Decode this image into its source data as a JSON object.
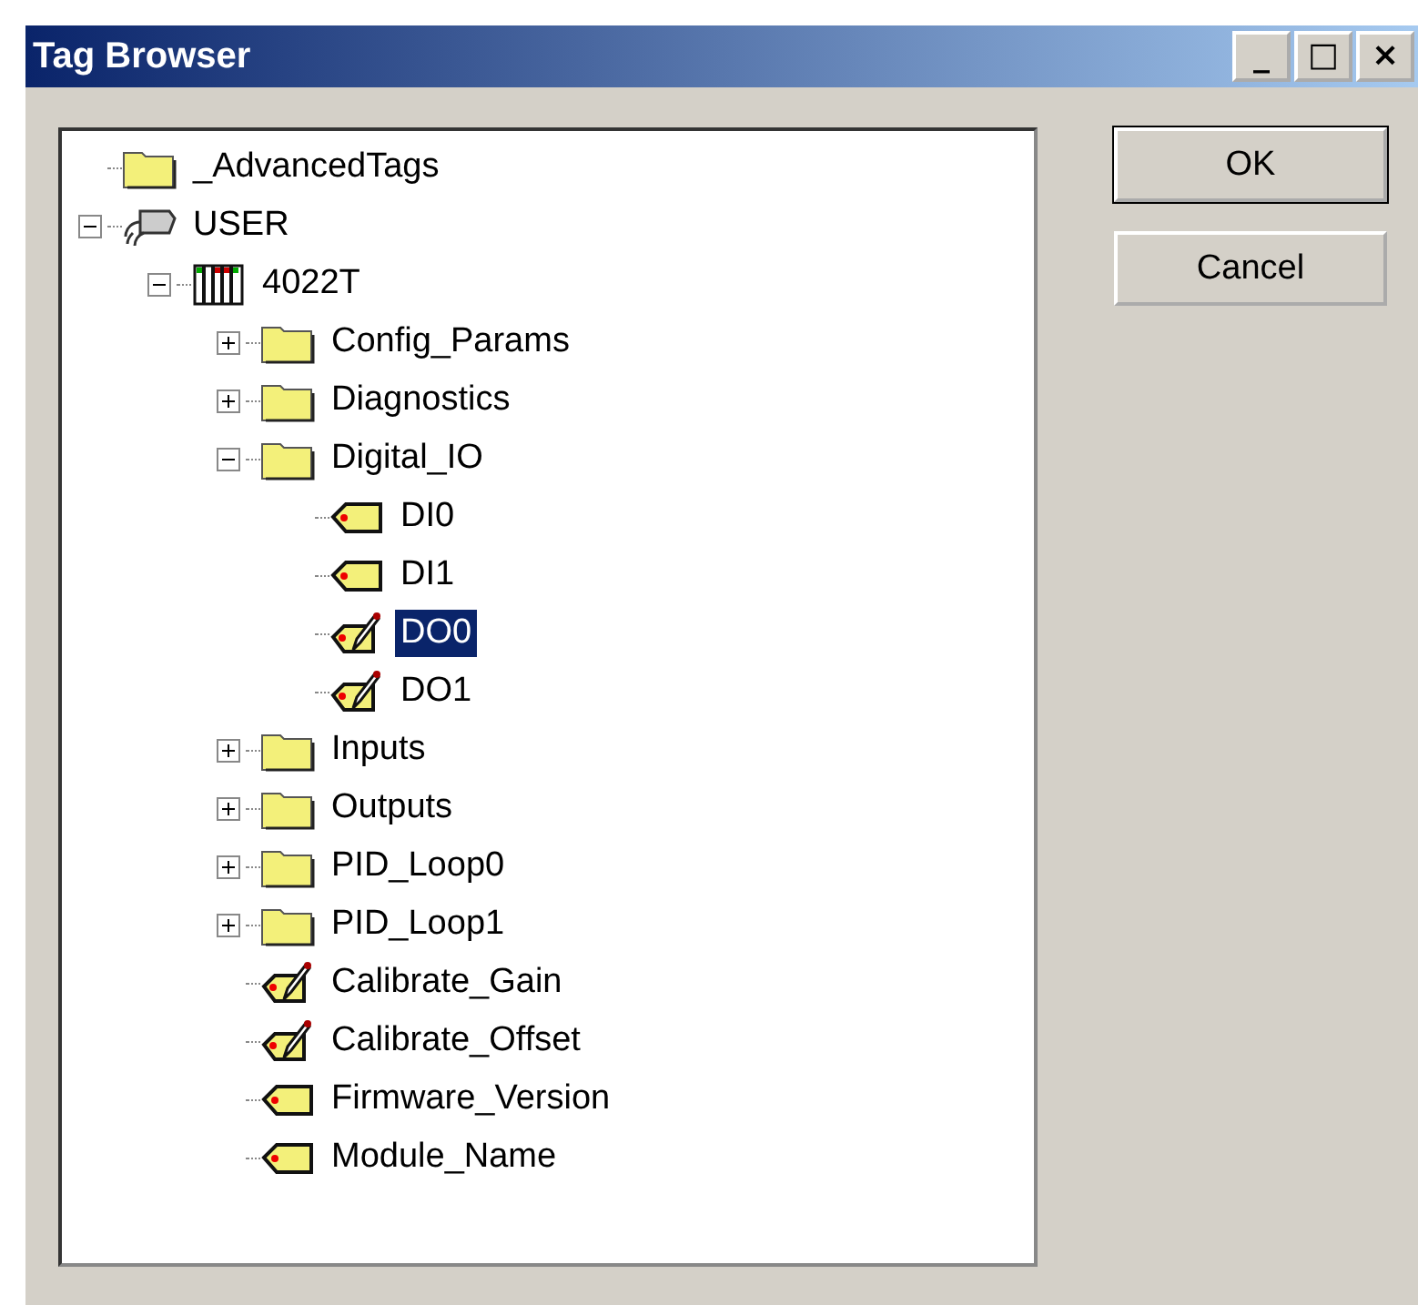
{
  "window": {
    "title": "Tag Browser",
    "controls": [
      "_",
      "□",
      "×"
    ]
  },
  "tree": [
    {
      "label": "_AdvancedTags",
      "kind": "folder",
      "selected": false
    },
    {
      "label": "USER",
      "kind": "device",
      "selected": false,
      "expanded": true,
      "children": [
        {
          "label": "4022T",
          "kind": "module",
          "selected": false,
          "expanded": true,
          "children": [
            {
              "label": "Config_Params",
              "kind": "folder",
              "selected": false,
              "expanded": false
            },
            {
              "label": "Diagnostics",
              "kind": "folder",
              "selected": false,
              "expanded": false
            },
            {
              "label": "Digital_IO",
              "kind": "folder",
              "selected": false,
              "expanded": true,
              "children": [
                {
                  "label": "DI0",
                  "kind": "tag",
                  "selected": false
                },
                {
                  "label": "DI1",
                  "kind": "tag",
                  "selected": false
                },
                {
                  "label": "DO0",
                  "kind": "writable_tag",
                  "selected": true
                },
                {
                  "label": "DO1",
                  "kind": "writable_tag",
                  "selected": false
                }
              ]
            },
            {
              "label": "Inputs",
              "kind": "folder",
              "selected": false,
              "expanded": false
            },
            {
              "label": "Outputs",
              "kind": "folder",
              "selected": false,
              "expanded": false
            },
            {
              "label": "PID_Loop0",
              "kind": "folder",
              "selected": false,
              "expanded": false
            },
            {
              "label": "PID_Loop1",
              "kind": "folder",
              "selected": false,
              "expanded": false
            },
            {
              "label": "Calibrate_Gain",
              "kind": "writable_tag",
              "selected": false
            },
            {
              "label": "Calibrate_Offset",
              "kind": "writable_tag",
              "selected": false
            },
            {
              "label": "Firmware_Version",
              "kind": "tag",
              "selected": false
            },
            {
              "label": "Module_Name",
              "kind": "tag",
              "selected": false
            }
          ]
        }
      ]
    }
  ],
  "buttons": [
    "OK",
    "Cancel"
  ]
}
